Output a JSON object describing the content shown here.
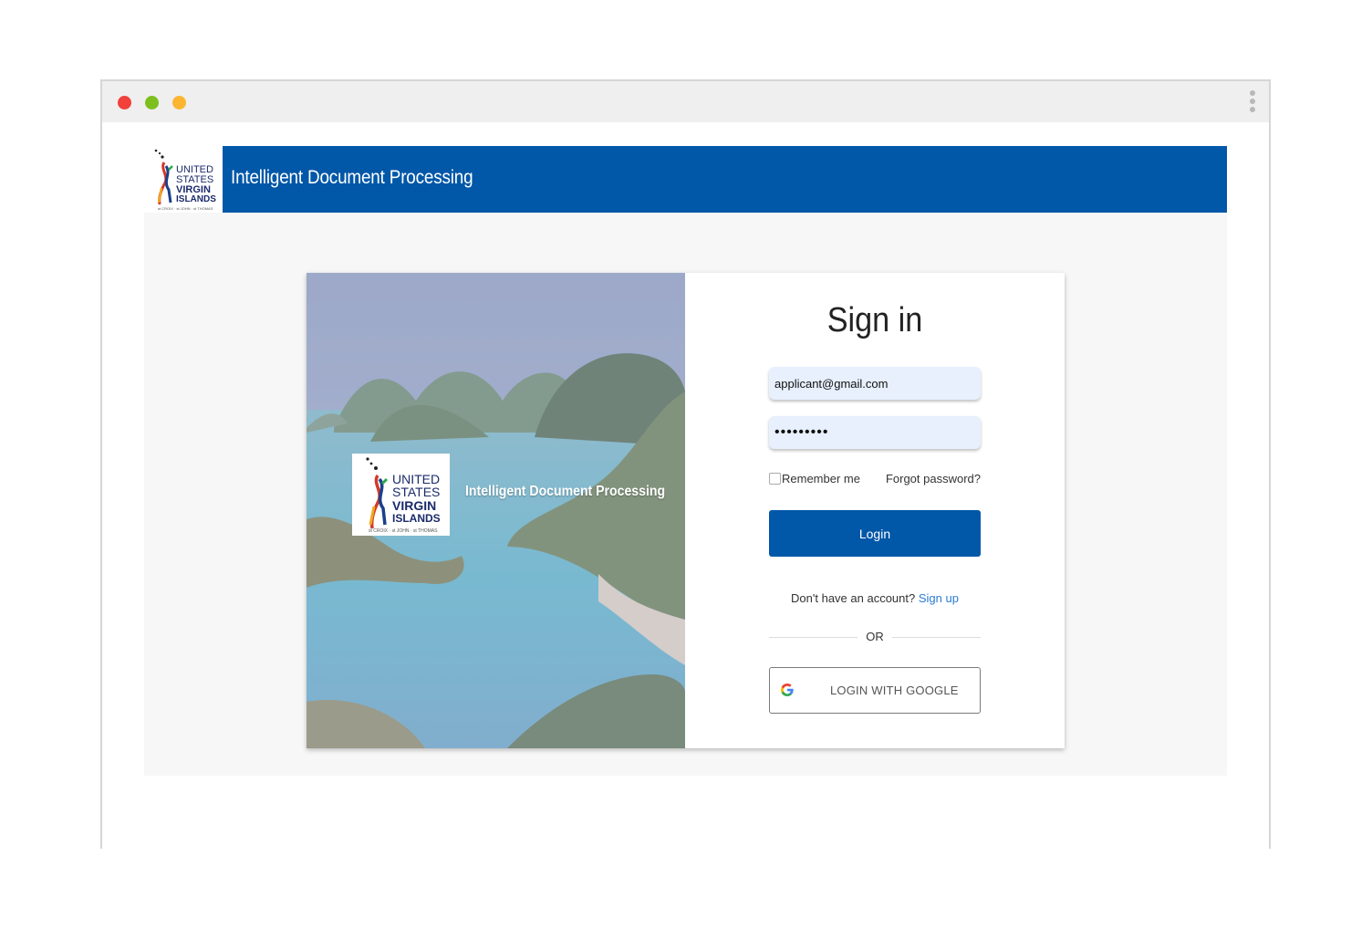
{
  "browser": {
    "controls": [
      "close",
      "minimize",
      "maximize"
    ],
    "menu_icon": "kebab-menu-icon"
  },
  "header": {
    "title": "Intelligent Document Processing",
    "logo_text": [
      "UNITED",
      "STATES",
      "VIRGIN",
      "ISLANDS"
    ],
    "logo_subtext": "st CROIX · st JOHN · st THOMAS",
    "bg_color": "#0157a8"
  },
  "hero": {
    "title": "Intelligent Document Processing",
    "logo_text": [
      "UNITED",
      "STATES",
      "VIRGIN",
      "ISLANDS"
    ],
    "logo_subtext": "st CROIX · st JOHN · st THOMAS"
  },
  "signin": {
    "title": "Sign in",
    "email_value": "applicant@gmail.com",
    "password_value": "•••••••••",
    "remember_label": "Remember me",
    "forgot_label": "Forgot password?",
    "login_label": "Login",
    "no_account_text": "Don't have an account?",
    "signup_label": "Sign up",
    "or_label": "OR",
    "google_label": "LOGIN WITH GOOGLE"
  },
  "colors": {
    "primary": "#0157a8",
    "link": "#2a7bd4",
    "field_bg": "#e8f0fd"
  }
}
